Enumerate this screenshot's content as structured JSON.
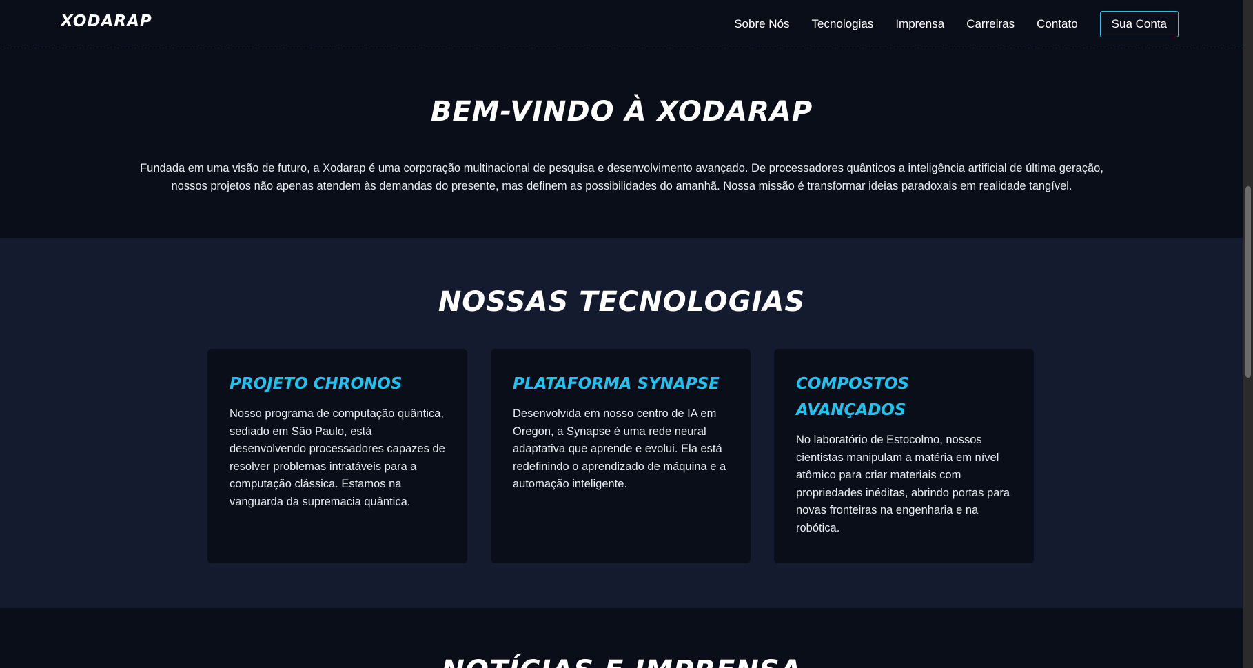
{
  "header": {
    "logo": "XODARAP",
    "nav": [
      "Sobre Nós",
      "Tecnologias",
      "Imprensa",
      "Carreiras",
      "Contato"
    ],
    "account_button": "Sua Conta"
  },
  "welcome": {
    "title": "BEM-VINDO À XODARAP",
    "text": "Fundada em uma visão de futuro, a Xodarap é uma corporação multinacional de pesquisa e desenvolvimento avançado. De processadores quânticos a inteligência artificial de última geração, nossos projetos não apenas atendem às demandas do presente, mas definem as possibilidades do amanhã. Nossa missão é transformar ideias paradoxais em realidade tangível."
  },
  "tech": {
    "title": "NOSSAS TECNOLOGIAS",
    "cards": [
      {
        "title": "PROJETO CHRONOS",
        "text": "Nosso programa de computação quântica, sediado em São Paulo, está desenvolvendo processadores capazes de resolver problemas intratáveis para a computação clássica. Estamos na vanguarda da supremacia quântica."
      },
      {
        "title": "PLATAFORMA SYNAPSE",
        "text": "Desenvolvida em nosso centro de IA em Oregon, a Synapse é uma rede neural adaptativa que aprende e evolui. Ela está redefinindo o aprendizado de máquina e a automação inteligente."
      },
      {
        "title": "COMPOSTOS AVANÇADOS",
        "text": "No laboratório de Estocolmo, nossos cientistas manipulam a matéria em nível atômico para criar materiais com propriedades inéditas, abrindo portas para novas fronteiras na engenharia e na robótica."
      }
    ]
  },
  "news": {
    "title": "NOTÍCIAS E IMPRENSA"
  },
  "colors": {
    "accent": "#1ec3f0",
    "background_dark": "#0a0e18",
    "background_section": "#141b2e"
  }
}
